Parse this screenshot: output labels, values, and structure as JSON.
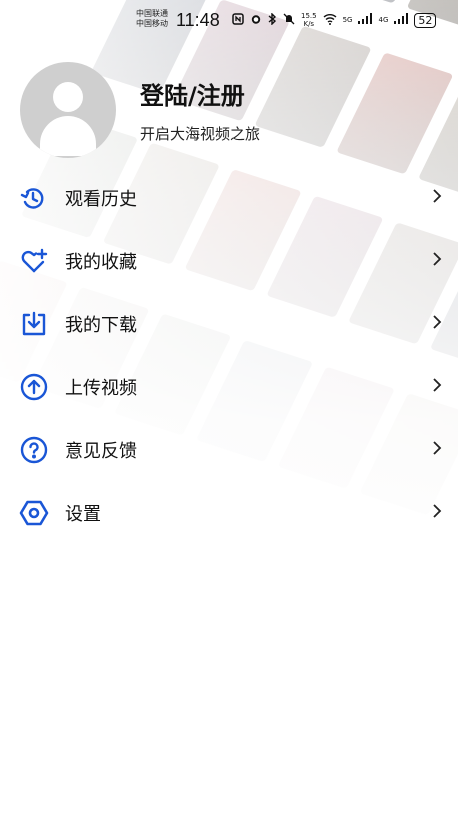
{
  "status_bar": {
    "carrier_1": "中国联通",
    "carrier_2": "中国移动",
    "time": "11:48",
    "net_speed_value": "15.5",
    "net_speed_unit": "K/s",
    "signal_1": "5G",
    "signal_2": "4G",
    "battery": "52"
  },
  "profile": {
    "login_title": "登陆/注册",
    "subtitle": "开启大海视频之旅"
  },
  "menu": {
    "items": [
      {
        "label": "观看历史",
        "icon": "history-icon"
      },
      {
        "label": "我的收藏",
        "icon": "heart-icon"
      },
      {
        "label": "我的下载",
        "icon": "download-icon"
      },
      {
        "label": "上传视频",
        "icon": "upload-icon"
      },
      {
        "label": "意见反馈",
        "icon": "help-icon"
      },
      {
        "label": "设置",
        "icon": "settings-icon"
      }
    ]
  },
  "colors": {
    "accent": "#1a56d6",
    "text": "#111111",
    "avatar_bg": "#cfcfcf"
  }
}
